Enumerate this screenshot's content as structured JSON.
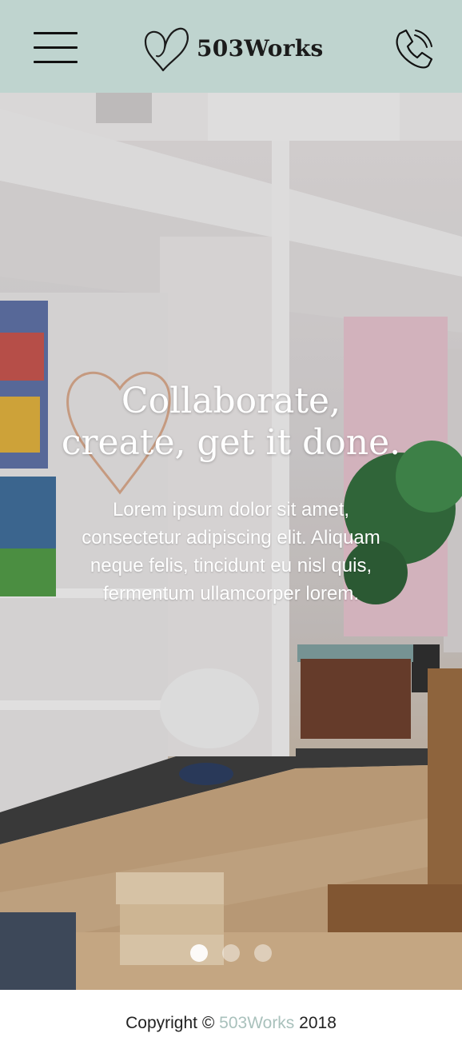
{
  "header": {
    "brand": "503Works",
    "menu_icon": "hamburger-menu-icon",
    "phone_icon": "phone-icon",
    "logo_icon": "heart-icon",
    "background_color": "#bfd4cf"
  },
  "hero": {
    "title_line1": "Collaborate,",
    "title_line2": "create, get it done.",
    "body": "Lorem ipsum dolor sit amet, consectetur adipiscing elit. Aliquam neque felis, tincidunt eu nisl quis, fermentum ullamcorper lorem.",
    "slides": {
      "count": 3,
      "active": 1
    }
  },
  "footer": {
    "prefix": "Copyright ©",
    "brand": "503Works",
    "year": "2018",
    "brand_color": "#a9c1bc"
  }
}
